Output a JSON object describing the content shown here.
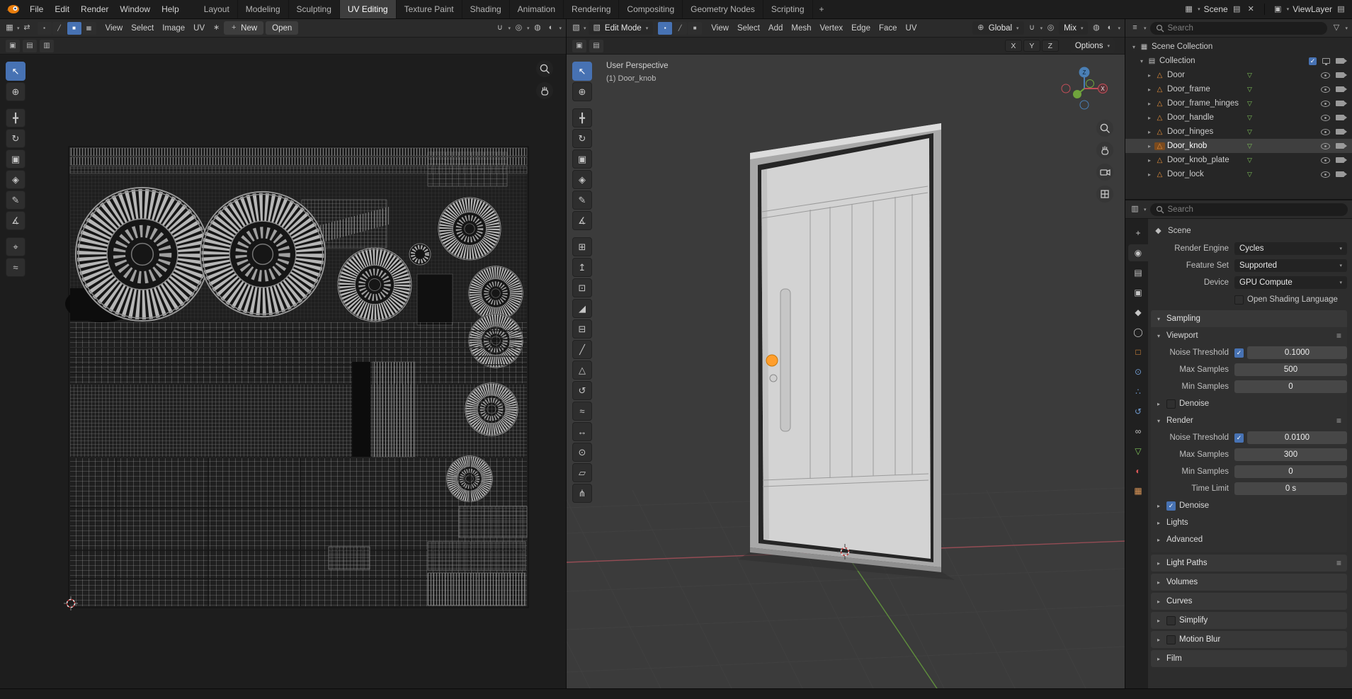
{
  "colors": {
    "accent_blue": "#4772b3",
    "object_orange": "#e8913c",
    "mesh_green": "#7fc45a",
    "axis_red": "#c24e58",
    "axis_green": "#6fa33c",
    "axis_blue": "#4a7fb5",
    "knob_orange": "#ff9e2c"
  },
  "topbar": {
    "menus": [
      {
        "label": "File"
      },
      {
        "label": "Edit"
      },
      {
        "label": "Render"
      },
      {
        "label": "Window"
      },
      {
        "label": "Help"
      }
    ],
    "workspaces": [
      {
        "label": "Layout"
      },
      {
        "label": "Modeling"
      },
      {
        "label": "Sculpting"
      },
      {
        "label": "UV Editing",
        "active": true
      },
      {
        "label": "Texture Paint"
      },
      {
        "label": "Shading"
      },
      {
        "label": "Animation"
      },
      {
        "label": "Rendering"
      },
      {
        "label": "Compositing"
      },
      {
        "label": "Geometry Nodes"
      },
      {
        "label": "Scripting"
      }
    ],
    "add_workspace": "+",
    "scene_label": "Scene",
    "viewlayer_label": "ViewLayer"
  },
  "uv_editor": {
    "menus": [
      {
        "label": "View"
      },
      {
        "label": "Select"
      },
      {
        "label": "Image"
      },
      {
        "label": "UV"
      }
    ],
    "select_modes": [
      {
        "name": "uv-vertex-select",
        "glyph": "▪"
      },
      {
        "name": "uv-edge-select",
        "glyph": "╱"
      },
      {
        "name": "uv-face-select",
        "glyph": "■",
        "active": true
      },
      {
        "name": "uv-island-select",
        "glyph": "▦"
      }
    ],
    "new_button": "New",
    "open_button": "Open",
    "tools": [
      {
        "name": "tweak-select-tool",
        "glyph": "↖",
        "active": true
      },
      {
        "name": "cursor-tool",
        "glyph": "⊕"
      },
      {
        "name": "move-tool",
        "glyph": "╋"
      },
      {
        "name": "rotate-tool",
        "glyph": "↻"
      },
      {
        "name": "scale-tool",
        "glyph": "▣"
      },
      {
        "name": "transform-tool",
        "glyph": "◈"
      },
      {
        "name": "annotate-tool",
        "glyph": "✎"
      },
      {
        "name": "measure-tool",
        "glyph": "∡"
      },
      {
        "name": "grab-tool",
        "glyph": "⌖"
      },
      {
        "name": "relax-tool",
        "glyph": "≈"
      }
    ]
  },
  "viewport3d": {
    "mode": "Edit Mode",
    "select_modes": [
      {
        "name": "vertex-select",
        "glyph": "▪",
        "active": true
      },
      {
        "name": "edge-select",
        "glyph": "╱"
      },
      {
        "name": "face-select",
        "glyph": "■"
      }
    ],
    "menus": [
      {
        "label": "View"
      },
      {
        "label": "Select"
      },
      {
        "label": "Add"
      },
      {
        "label": "Mesh"
      },
      {
        "label": "Vertex"
      },
      {
        "label": "Edge"
      },
      {
        "label": "Face"
      },
      {
        "label": "UV"
      }
    ],
    "orientation": "Global",
    "falloff": "Mix",
    "options_label": "Options",
    "mirror_axes": [
      "X",
      "Y",
      "Z"
    ],
    "overlay": {
      "line1": "User Perspective",
      "line2": "(1) Door_knob"
    },
    "gizmo": {
      "x": "X",
      "z": "Z"
    },
    "tools": [
      {
        "name": "select-box-tool",
        "glyph": "↖",
        "active": true
      },
      {
        "name": "cursor-tool",
        "glyph": "⊕"
      },
      {
        "name": "move-tool",
        "glyph": "╋"
      },
      {
        "name": "rotate-tool",
        "glyph": "↻"
      },
      {
        "name": "scale-tool",
        "glyph": "▣"
      },
      {
        "name": "transform-tool",
        "glyph": "◈"
      },
      {
        "name": "annotate-tool",
        "glyph": "✎"
      },
      {
        "name": "measure-tool",
        "glyph": "∡"
      },
      {
        "name": "add-cube-tool",
        "glyph": "⊞"
      },
      {
        "name": "extrude-region-tool",
        "glyph": "↥"
      },
      {
        "name": "inset-faces-tool",
        "glyph": "⊡"
      },
      {
        "name": "bevel-tool",
        "glyph": "◢"
      },
      {
        "name": "loop-cut-tool",
        "glyph": "⊟"
      },
      {
        "name": "knife-tool",
        "glyph": "╱"
      },
      {
        "name": "poly-build-tool",
        "glyph": "△"
      },
      {
        "name": "spin-tool",
        "glyph": "↺"
      },
      {
        "name": "smooth-tool",
        "glyph": "≈"
      },
      {
        "name": "edge-slide-tool",
        "glyph": "↔"
      },
      {
        "name": "shrink-fatten-tool",
        "glyph": "⊙"
      },
      {
        "name": "shear-tool",
        "glyph": "▱"
      },
      {
        "name": "rip-region-tool",
        "glyph": "⋔"
      }
    ]
  },
  "outliner": {
    "search_placeholder": "Search",
    "root_label": "Scene Collection",
    "collection_label": "Collection",
    "collection_checked": true,
    "objects": [
      {
        "name": "Door"
      },
      {
        "name": "Door_frame"
      },
      {
        "name": "Door_frame_hinges"
      },
      {
        "name": "Door_handle"
      },
      {
        "name": "Door_hinges"
      },
      {
        "name": "Door_knob",
        "active": true
      },
      {
        "name": "Door_knob_plate"
      },
      {
        "name": "Door_lock"
      }
    ]
  },
  "properties": {
    "search_placeholder": "Search",
    "breadcrumb": "Scene",
    "tabs": [
      {
        "name": "tool-tab",
        "glyph": "+",
        "color": "#c5c5c5"
      },
      {
        "name": "render-tab",
        "glyph": "◉",
        "color": "#c5c5c5",
        "active": true
      },
      {
        "name": "output-tab",
        "glyph": "▤",
        "color": "#c5c5c5"
      },
      {
        "name": "view-layer-tab",
        "glyph": "▣",
        "color": "#c5c5c5"
      },
      {
        "name": "scene-tab",
        "glyph": "◆",
        "color": "#c5c5c5"
      },
      {
        "name": "world-tab",
        "glyph": "◯",
        "color": "#c5c5c5"
      },
      {
        "name": "object-tab",
        "glyph": "□",
        "color": "#e8913c"
      },
      {
        "name": "modifiers-tab",
        "glyph": "⊙",
        "color": "#6f9ad0"
      },
      {
        "name": "particles-tab",
        "glyph": "∴",
        "color": "#6f9ad0"
      },
      {
        "name": "physics-tab",
        "glyph": "↺",
        "color": "#6f9ad0"
      },
      {
        "name": "constraints-tab",
        "glyph": "∞",
        "color": "#c5c5c5"
      },
      {
        "name": "data-tab",
        "glyph": "▽",
        "color": "#7fc45a"
      },
      {
        "name": "material-tab",
        "glyph": "◐",
        "color": "#d95757"
      },
      {
        "name": "texture-tab",
        "glyph": "▦",
        "color": "#d99557"
      }
    ],
    "fields": {
      "render_engine": {
        "label": "Render Engine",
        "value": "Cycles"
      },
      "feature_set": {
        "label": "Feature Set",
        "value": "Supported"
      },
      "device": {
        "label": "Device",
        "value": "GPU Compute"
      },
      "osl": {
        "label": "Open Shading Language",
        "checked": false
      }
    },
    "sampling": {
      "title": "Sampling",
      "viewport": {
        "title": "Viewport",
        "noise_threshold": {
          "label": "Noise Threshold",
          "checked": true,
          "value": "0.1000"
        },
        "max_samples": {
          "label": "Max Samples",
          "value": "500"
        },
        "min_samples": {
          "label": "Min Samples",
          "value": "0"
        },
        "denoise": {
          "label": "Denoise",
          "checked": false
        }
      },
      "render": {
        "title": "Render",
        "noise_threshold": {
          "label": "Noise Threshold",
          "checked": true,
          "value": "0.0100"
        },
        "max_samples": {
          "label": "Max Samples",
          "value": "300"
        },
        "min_samples": {
          "label": "Min Samples",
          "value": "0"
        },
        "time_limit": {
          "label": "Time Limit",
          "value": "0 s"
        },
        "denoise": {
          "label": "Denoise",
          "checked": true
        }
      },
      "lights_label": "Lights",
      "advanced_label": "Advanced"
    },
    "collapsed_panels": [
      {
        "label": "Light Paths",
        "preset": true
      },
      {
        "label": "Volumes"
      },
      {
        "label": "Curves"
      },
      {
        "label": "Simplify",
        "checkbox": true
      },
      {
        "label": "Motion Blur",
        "checkbox": true
      },
      {
        "label": "Film"
      }
    ]
  }
}
